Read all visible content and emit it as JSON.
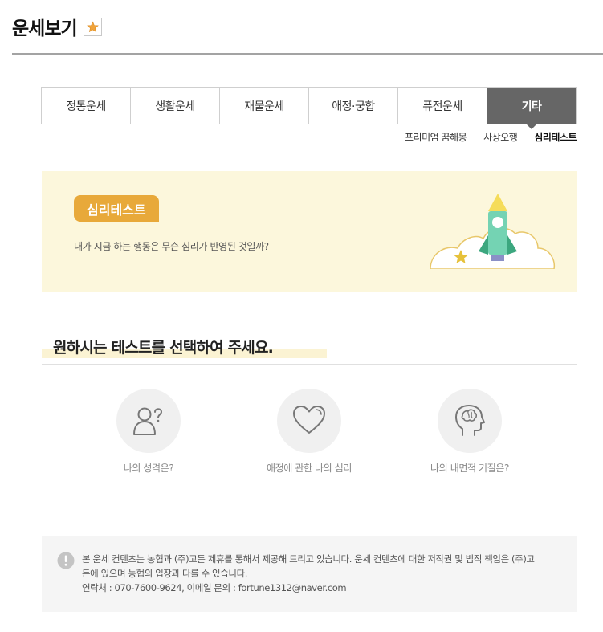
{
  "header": {
    "title": "운세보기",
    "favorite_icon": "star-icon"
  },
  "tabs": [
    {
      "label": "정통운세",
      "active": false
    },
    {
      "label": "생활운세",
      "active": false
    },
    {
      "label": "재물운세",
      "active": false
    },
    {
      "label": "애정·궁합",
      "active": false
    },
    {
      "label": "퓨전운세",
      "active": false
    },
    {
      "label": "기타",
      "active": true
    }
  ],
  "subtabs": [
    {
      "label": "프리미엄 꿈해몽",
      "active": false
    },
    {
      "label": "사상오행",
      "active": false
    },
    {
      "label": "심리테스트",
      "active": true
    }
  ],
  "banner": {
    "badge": "심리테스트",
    "description": "내가 지금 하는 행동은 무슨 심리가 반영된 것일까?",
    "illustration": "rocket-icon"
  },
  "section": {
    "title": "원하시는 테스트를 선택하여 주세요."
  },
  "tests": [
    {
      "label": "나의 성격은?",
      "icon": "person-question-icon"
    },
    {
      "label": "애정에 관한 나의 심리",
      "icon": "heart-icon"
    },
    {
      "label": "나의 내면적 기질은?",
      "icon": "head-brain-icon"
    }
  ],
  "notice": {
    "icon": "exclamation-icon",
    "line1": "본 운세 컨텐츠는 농협과 (주)고든 제휴를 통해서 제공해 드리고 있습니다. 운세 컨텐츠에 대한 저작권 및 법적 책임은 (주)고",
    "line2": "든에 있으며 농협의 입장과 다를 수 있습니다.",
    "line3": "연락처 : 070-7600-9624, 이메일 문의 : fortune1312@naver.com"
  },
  "colors": {
    "accent": "#e8a93a",
    "active_tab": "#666666",
    "banner_bg": "#fcf7dc"
  }
}
